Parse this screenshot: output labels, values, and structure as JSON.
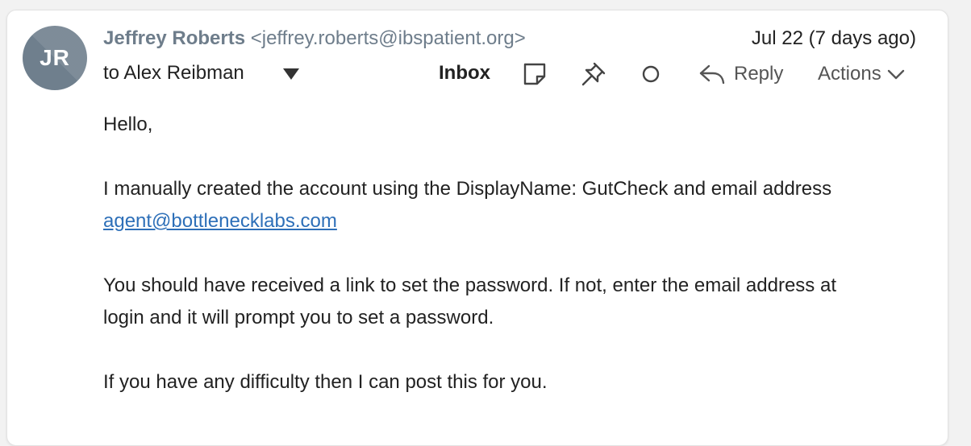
{
  "sender": {
    "initials": "JR",
    "name": "Jeffrey Roberts",
    "email": "<jeffrey.roberts@ibspatient.org>",
    "avatar_color": "#6f7f8d"
  },
  "date": "Jul 22 (7 days ago)",
  "recipient": "to Alex Reibman",
  "toolbar": {
    "folder_label": "Inbox",
    "note_icon": "sticky-note-icon",
    "pin_icon": "pin-icon",
    "circle_icon": "circle-icon",
    "reply_label": "Reply",
    "reply_icon": "reply-icon",
    "actions_label": "Actions",
    "actions_icon": "chevron-down-icon"
  },
  "body": {
    "greeting": "Hello,",
    "para1_text": "I manually created the account using the DisplayName: GutCheck and email address ",
    "para1_link": "agent@bottlenecklabs.com",
    "para2": "You should have received a link to set the password. If not, enter the email address at login and it will prompt you to set a password.",
    "para3": "If you have any difficulty then I can post this for you."
  },
  "colors": {
    "link": "#2d6fb8",
    "muted": "#6e7d8b",
    "text": "#222222"
  }
}
